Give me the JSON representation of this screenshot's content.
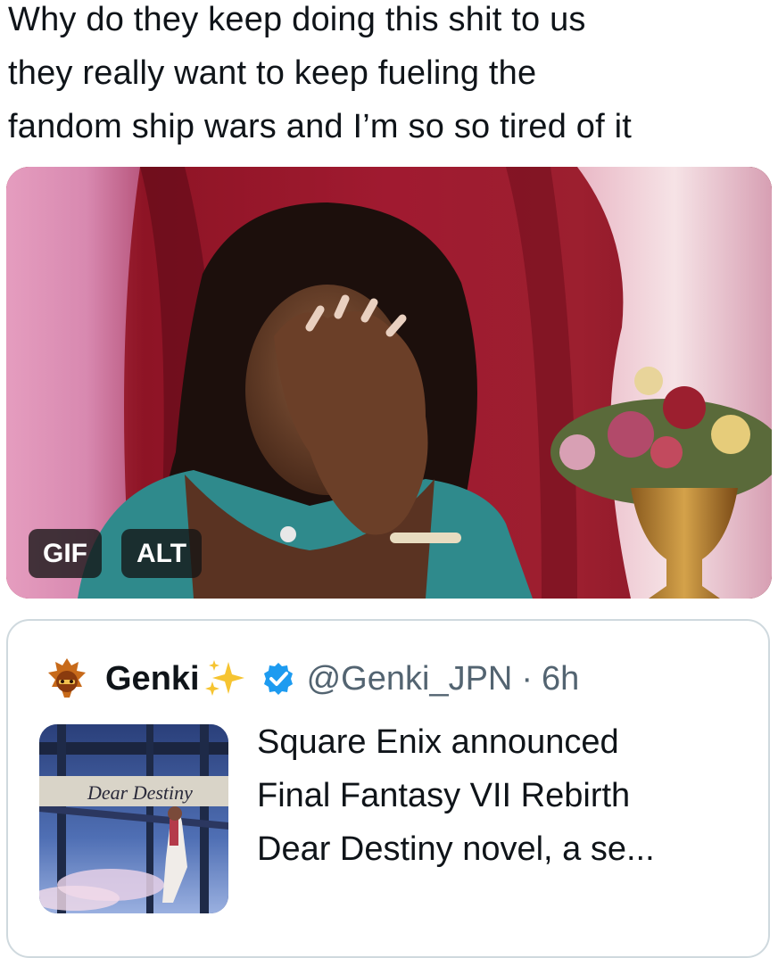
{
  "tweet": {
    "lines": [
      "Why do they keep doing this shit to us",
      "they really want to keep fueling the",
      "fandom ship wars and I’m so so tired of it"
    ]
  },
  "media": {
    "badges": {
      "gif": "GIF",
      "alt": "ALT"
    }
  },
  "quote": {
    "name": "Genki",
    "handle": "@Genki_JPN",
    "separator": "·",
    "time": "6h",
    "text_lines": [
      "Square Enix announced",
      "Final Fantasy VII Rebirth",
      "Dear Destiny novel, a se..."
    ],
    "thumbnail": {
      "title": "Dear Destiny"
    }
  },
  "colors": {
    "text": "#0f1419",
    "secondary": "#536471",
    "border": "#cfd9de",
    "verified": "#1d9bf0"
  }
}
